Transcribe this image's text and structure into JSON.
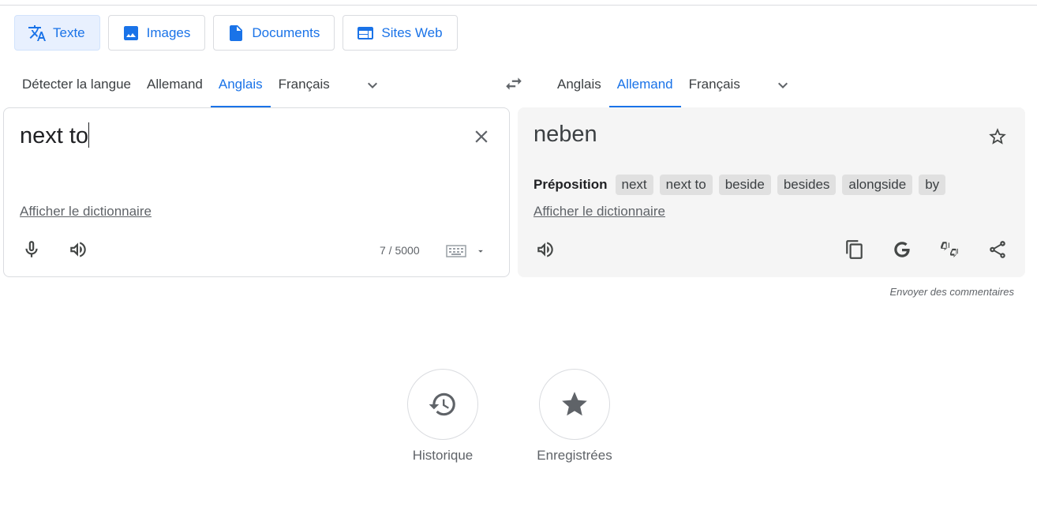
{
  "modes": [
    {
      "label": "Texte",
      "icon": "translate-icon",
      "active": true
    },
    {
      "label": "Images",
      "icon": "image-icon",
      "active": false
    },
    {
      "label": "Documents",
      "icon": "document-icon",
      "active": false
    },
    {
      "label": "Sites Web",
      "icon": "website-icon",
      "active": false
    }
  ],
  "source_langs": [
    "Détecter la langue",
    "Allemand",
    "Anglais",
    "Français"
  ],
  "source_active": "Anglais",
  "target_langs": [
    "Anglais",
    "Allemand",
    "Français"
  ],
  "target_active": "Allemand",
  "source": {
    "text": "next to",
    "dictionary_link": "Afficher le dictionnaire",
    "char_count": "7 / 5000"
  },
  "target": {
    "text": "neben",
    "part_of_speech": "Préposition",
    "alternatives": [
      "next",
      "next to",
      "beside",
      "besides",
      "alongside",
      "by"
    ],
    "dictionary_link": "Afficher le dictionnaire"
  },
  "feedback_link": "Envoyer des commentaires",
  "history_label": "Historique",
  "saved_label": "Enregistrées",
  "colors": {
    "accent": "#1a73e8",
    "active_bg": "#e8f0fe",
    "target_panel": "#f5f5f5"
  }
}
